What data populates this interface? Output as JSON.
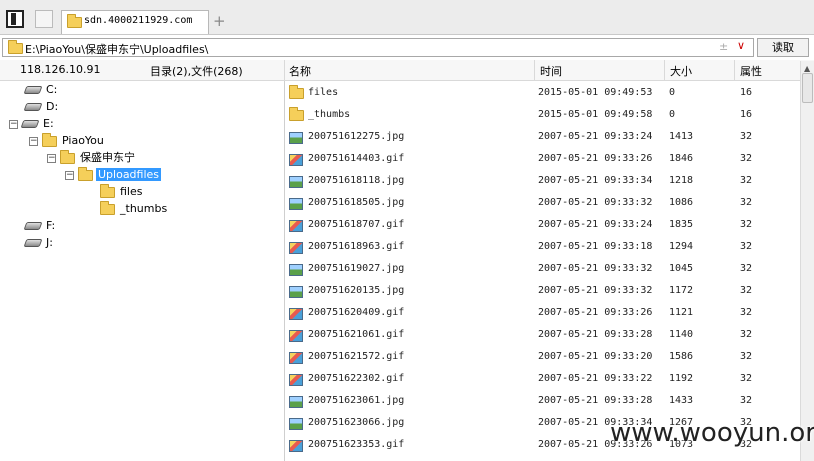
{
  "tab": {
    "title": "sdn.4000211929.com",
    "new_tab": "+"
  },
  "address": {
    "path": "E:\\PiaoYou\\保盛申东宁\\Uploadfiles\\",
    "star": "±",
    "dropdown": "∨",
    "read_label": "读取"
  },
  "header": {
    "ip": "118.126.10.91",
    "summary": "目录(2),文件(268)",
    "col_name": "名称",
    "col_time": "时间",
    "col_size": "大小",
    "col_attr": "属性"
  },
  "tree": {
    "drive_c": "C:",
    "drive_d": "D:",
    "drive_e": "E:",
    "piaoyou": "PiaoYou",
    "baosheng": "保盛申东宁",
    "uploadfiles": "Uploadfiles",
    "files": "files",
    "thumbs": "_thumbs",
    "drive_f": "F:",
    "drive_j": "J:"
  },
  "files": [
    {
      "type": "folder",
      "name": "files",
      "time": "2015-05-01 09:49:53",
      "size": "0",
      "attr": "16"
    },
    {
      "type": "folder",
      "name": "_thumbs",
      "time": "2015-05-01 09:49:58",
      "size": "0",
      "attr": "16"
    },
    {
      "type": "jpg",
      "name": "200751612275.jpg",
      "time": "2007-05-21 09:33:24",
      "size": "1413",
      "attr": "32"
    },
    {
      "type": "gif",
      "name": "200751614403.gif",
      "time": "2007-05-21 09:33:26",
      "size": "1846",
      "attr": "32"
    },
    {
      "type": "jpg",
      "name": "200751618118.jpg",
      "time": "2007-05-21 09:33:34",
      "size": "1218",
      "attr": "32"
    },
    {
      "type": "jpg",
      "name": "200751618505.jpg",
      "time": "2007-05-21 09:33:32",
      "size": "1086",
      "attr": "32"
    },
    {
      "type": "gif",
      "name": "200751618707.gif",
      "time": "2007-05-21 09:33:24",
      "size": "1835",
      "attr": "32"
    },
    {
      "type": "gif",
      "name": "200751618963.gif",
      "time": "2007-05-21 09:33:18",
      "size": "1294",
      "attr": "32"
    },
    {
      "type": "jpg",
      "name": "200751619027.jpg",
      "time": "2007-05-21 09:33:32",
      "size": "1045",
      "attr": "32"
    },
    {
      "type": "jpg",
      "name": "200751620135.jpg",
      "time": "2007-05-21 09:33:32",
      "size": "1172",
      "attr": "32"
    },
    {
      "type": "gif",
      "name": "200751620409.gif",
      "time": "2007-05-21 09:33:26",
      "size": "1121",
      "attr": "32"
    },
    {
      "type": "gif",
      "name": "200751621061.gif",
      "time": "2007-05-21 09:33:28",
      "size": "1140",
      "attr": "32"
    },
    {
      "type": "gif",
      "name": "200751621572.gif",
      "time": "2007-05-21 09:33:20",
      "size": "1586",
      "attr": "32"
    },
    {
      "type": "gif",
      "name": "200751622302.gif",
      "time": "2007-05-21 09:33:22",
      "size": "1192",
      "attr": "32"
    },
    {
      "type": "jpg",
      "name": "200751623061.jpg",
      "time": "2007-05-21 09:33:28",
      "size": "1433",
      "attr": "32"
    },
    {
      "type": "jpg",
      "name": "200751623066.jpg",
      "time": "2007-05-21 09:33:34",
      "size": "1267",
      "attr": "32"
    },
    {
      "type": "gif",
      "name": "200751623353.gif",
      "time": "2007-05-21 09:33:26",
      "size": "1073",
      "attr": "32"
    }
  ],
  "watermark": "www.wooyun.org"
}
